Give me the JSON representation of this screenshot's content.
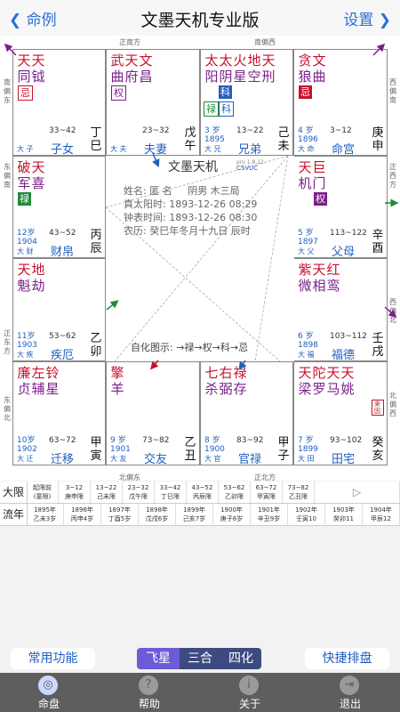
{
  "nav": {
    "back_label": "命例",
    "title": "文墨天机专业版",
    "settings_label": "设置"
  },
  "directions": {
    "top_mid": "正南方",
    "top_right": "南偏西",
    "left_1": "南偏东",
    "right_1": "西偏南",
    "left_2": "东偏南",
    "right_2": "正西方",
    "left_3": "正东方",
    "right_3": "西偏北",
    "left_4": "东偏北",
    "right_4": "北偏西",
    "bottom_left": "北偏东",
    "bottom_mid": "正北方"
  },
  "palaces": [
    {
      "id": "si",
      "stars": [
        {
          "t": "天",
          "c": "red"
        },
        {
          "t": "天",
          "c": "red"
        }
      ],
      "stars2": [
        {
          "t": "同",
          "c": "purple"
        },
        {
          "t": "钺",
          "c": "purple"
        }
      ],
      "sihua": "忌",
      "sihua_type": "ji_box",
      "age": "",
      "age_year": "",
      "range": "33~42",
      "daxian": "大 子",
      "name": "子女",
      "gan": "丁",
      "zhi": "巳"
    },
    {
      "id": "wu",
      "stars": [
        {
          "t": "武",
          "c": "red"
        },
        {
          "t": "天",
          "c": "red"
        },
        {
          "t": "文",
          "c": "red"
        }
      ],
      "stars2": [
        {
          "t": "曲",
          "c": "purple"
        },
        {
          "t": "府",
          "c": "purple"
        },
        {
          "t": "昌",
          "c": "purple"
        }
      ],
      "sihua": "权",
      "sihua_type": "quan_box",
      "age": "",
      "age_year": "",
      "range": "23~32",
      "daxian": "大 夫",
      "name": "夫妻",
      "gan": "戊",
      "zhi": "午"
    },
    {
      "id": "wei",
      "stars": [
        {
          "t": "太",
          "c": "red"
        },
        {
          "t": "太",
          "c": "red"
        },
        {
          "t": "火",
          "c": "red"
        },
        {
          "t": "地",
          "c": "red"
        },
        {
          "t": "天",
          "c": "red"
        }
      ],
      "stars2": [
        {
          "t": "阳",
          "c": "purple"
        },
        {
          "t": "阴",
          "c": "purple"
        },
        {
          "t": "星",
          "c": "purple"
        },
        {
          "t": "空",
          "c": "purple"
        },
        {
          "t": "刑",
          "c": "purple"
        }
      ],
      "sihua": "科",
      "sihua_type": "ke",
      "extra1": "禄",
      "extra2": "科",
      "age": "3 岁",
      "age_year": "1895",
      "range": "13~22",
      "daxian": "大 兄",
      "name": "兄弟",
      "gan": "己",
      "zhi": "未"
    },
    {
      "id": "shen",
      "stars": [
        {
          "t": "贪",
          "c": "red"
        },
        {
          "t": "文",
          "c": "red"
        }
      ],
      "stars2": [
        {
          "t": "狼",
          "c": "purple"
        },
        {
          "t": "曲",
          "c": "purple"
        }
      ],
      "sihua": "忌",
      "sihua_type": "ji",
      "age": "4 岁",
      "age_year": "1896",
      "range": "3~12",
      "daxian": "大 命",
      "name": "命宫",
      "gan": "庚",
      "zhi": "申"
    },
    {
      "id": "chen",
      "stars": [
        {
          "t": "破",
          "c": "red"
        },
        {
          "t": "天",
          "c": "red"
        }
      ],
      "stars2": [
        {
          "t": "军",
          "c": "purple"
        },
        {
          "t": "喜",
          "c": "purple"
        }
      ],
      "sihua": "禄",
      "sihua_type": "lu",
      "age": "12岁",
      "age_year": "1904",
      "range": "43~52",
      "daxian": "大 财",
      "name": "财帛",
      "gan": "丙",
      "zhi": "辰"
    },
    {
      "id": "you",
      "stars": [
        {
          "t": "天",
          "c": "red"
        },
        {
          "t": "巨",
          "c": "red"
        }
      ],
      "stars2": [
        {
          "t": "机",
          "c": "purple"
        },
        {
          "t": "门",
          "c": "purple"
        }
      ],
      "sihua": "权",
      "sihua_type": "quan",
      "age": "5 岁",
      "age_year": "1897",
      "range": "113~122",
      "daxian": "大 父",
      "name": "父母",
      "gan": "辛",
      "zhi": "酉"
    },
    {
      "id": "mao",
      "stars": [
        {
          "t": "天",
          "c": "red"
        },
        {
          "t": "地",
          "c": "red"
        }
      ],
      "stars2": [
        {
          "t": "魁",
          "c": "purple"
        },
        {
          "t": "劫",
          "c": "purple"
        }
      ],
      "sihua": "",
      "sihua_type": "",
      "age": "11岁",
      "age_year": "1903",
      "range": "53~62",
      "daxian": "大 疾",
      "name": "疾厄",
      "gan": "乙",
      "zhi": "卯"
    },
    {
      "id": "xu",
      "stars": [
        {
          "t": "紫",
          "c": "red"
        },
        {
          "t": "天",
          "c": "red"
        },
        {
          "t": "红",
          "c": "red"
        }
      ],
      "stars2": [
        {
          "t": "微",
          "c": "purple"
        },
        {
          "t": "相",
          "c": "purple"
        },
        {
          "t": "鸾",
          "c": "purple"
        }
      ],
      "sihua": "",
      "sihua_type": "",
      "age": "6 岁",
      "age_year": "1898",
      "range": "103~112",
      "daxian": "大 福",
      "name": "福德",
      "gan": "壬",
      "zhi": "戌"
    },
    {
      "id": "yin",
      "stars": [
        {
          "t": "廉",
          "c": "red"
        },
        {
          "t": "左",
          "c": "red"
        },
        {
          "t": "铃",
          "c": "red"
        }
      ],
      "stars2": [
        {
          "t": "贞",
          "c": "purple"
        },
        {
          "t": "辅",
          "c": "purple"
        },
        {
          "t": "星",
          "c": "purple"
        }
      ],
      "sihua": "",
      "sihua_type": "",
      "age": "10岁",
      "age_year": "1902",
      "range": "63~72",
      "daxian": "大 迁",
      "name": "迁移",
      "gan": "甲",
      "zhi": "寅"
    },
    {
      "id": "chou",
      "stars": [
        {
          "t": "擎",
          "c": "red"
        }
      ],
      "stars2": [
        {
          "t": "羊",
          "c": "purple"
        }
      ],
      "sihua": "",
      "sihua_type": "",
      "age": "9 岁",
      "age_year": "1901",
      "range": "73~82",
      "daxian": "大 友",
      "name": "交友",
      "gan": "乙",
      "zhi": "丑"
    },
    {
      "id": "zi",
      "stars": [
        {
          "t": "七",
          "c": "red"
        },
        {
          "t": "右",
          "c": "red"
        },
        {
          "t": "禄",
          "c": "red"
        }
      ],
      "stars2": [
        {
          "t": "杀",
          "c": "purple"
        },
        {
          "t": "弼",
          "c": "purple"
        },
        {
          "t": "存",
          "c": "purple"
        }
      ],
      "sihua": "",
      "sihua_type": "",
      "age": "8 岁",
      "age_year": "1900",
      "range": "83~92",
      "daxian": "大 官",
      "name": "官禄",
      "gan": "甲",
      "zhi": "子"
    },
    {
      "id": "hai",
      "stars": [
        {
          "t": "天",
          "c": "red"
        },
        {
          "t": "陀",
          "c": "red"
        },
        {
          "t": "天",
          "c": "red"
        },
        {
          "t": "天",
          "c": "red"
        }
      ],
      "stars2": [
        {
          "t": "梁",
          "c": "purple"
        },
        {
          "t": "罗",
          "c": "purple"
        },
        {
          "t": "马",
          "c": "purple"
        },
        {
          "t": "姚",
          "c": "purple"
        }
      ],
      "sihua": "",
      "sihua_type": "",
      "extra_tag": "来因",
      "age": "7 岁",
      "age_year": "1899",
      "range": "93~102",
      "daxian": "大 田",
      "name": "田宅",
      "gan": "癸",
      "zhi": "亥"
    }
  ],
  "center": {
    "title": "文墨天机",
    "version": "pro 1.8.12",
    "code": "C5VUC",
    "name_label": "姓名: 匿 名",
    "gender": "阴男 木三局",
    "solar_time": "真太阳时: 1893-12-26 08:29",
    "clock_time": "钟表时间: 1893-12-26 08:30",
    "lunar": "农历: 癸巳年冬月十九日 辰时",
    "zihua": "自化图示: →禄→权→科→忌"
  },
  "daxian_row": {
    "label": "大限",
    "cells": [
      [
        "起限前",
        "(童限)"
      ],
      [
        "3~12",
        "庚申限"
      ],
      [
        "13~22",
        "己未限"
      ],
      [
        "23~32",
        "戊午限"
      ],
      [
        "33~42",
        "丁巳限"
      ],
      [
        "43~52",
        "丙辰限"
      ],
      [
        "53~62",
        "乙卯限"
      ],
      [
        "63~72",
        "甲寅限"
      ],
      [
        "73~82",
        "乙丑限"
      ]
    ],
    "next": "▷"
  },
  "liunian_row": {
    "label": "流年",
    "cells": [
      [
        "1895年",
        "乙未3岁"
      ],
      [
        "1896年",
        "丙申4岁"
      ],
      [
        "1897年",
        "丁酉5岁"
      ],
      [
        "1898年",
        "戊戌6岁"
      ],
      [
        "1899年",
        "己亥7岁"
      ],
      [
        "1900年",
        "庚子8岁"
      ],
      [
        "1901年",
        "辛丑9岁"
      ],
      [
        "1902年",
        "壬寅10"
      ],
      [
        "1903年",
        "癸卯11"
      ],
      [
        "1904年",
        "甲辰12"
      ]
    ]
  },
  "buttons": {
    "common": "常用功能",
    "quick": "快捷排盘"
  },
  "segments": [
    "飞星",
    "三合",
    "四化"
  ],
  "tabs": [
    {
      "label": "命盘",
      "icon": "◎"
    },
    {
      "label": "帮助",
      "icon": "?"
    },
    {
      "label": "关于",
      "icon": "i"
    },
    {
      "label": "退出",
      "icon": "⇥"
    }
  ],
  "colors": {
    "accent": "#2060c0",
    "red": "#c8102e",
    "purple": "#7b1f8a",
    "green": "#1f8a3a",
    "tabbar": "#5e5e5e"
  }
}
